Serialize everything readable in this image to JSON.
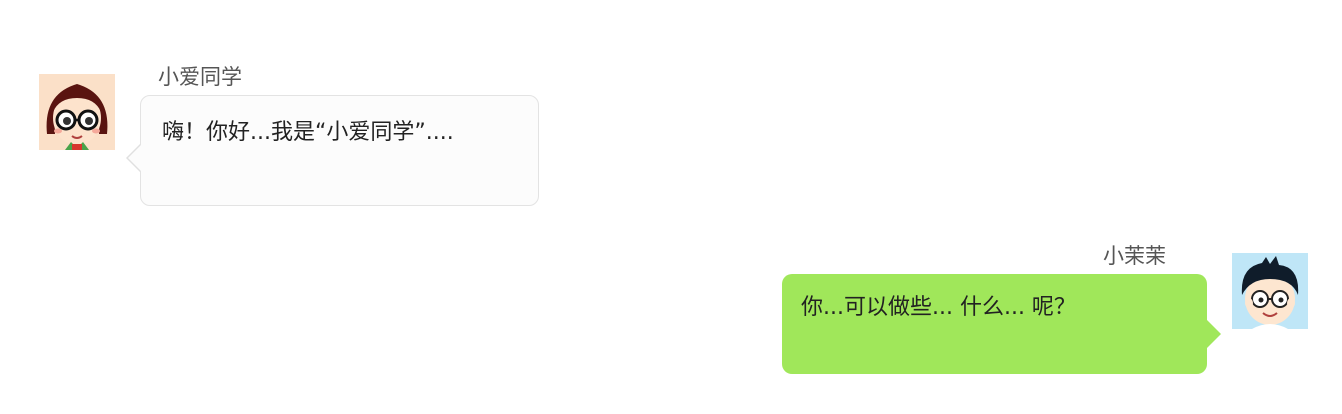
{
  "chat": {
    "messages": [
      {
        "sender": "小爱同学",
        "text": "嗨！你好...我是“小爱同学”....",
        "side": "left",
        "avatar_icon": "girl-with-glasses-avatar",
        "bubble_color": "#fcfcfc"
      },
      {
        "sender": "小茉茉",
        "text": "你...可以做些... 什么... 呢？",
        "side": "right",
        "avatar_icon": "boy-with-glasses-avatar",
        "bubble_color": "#a0e75a"
      }
    ]
  }
}
